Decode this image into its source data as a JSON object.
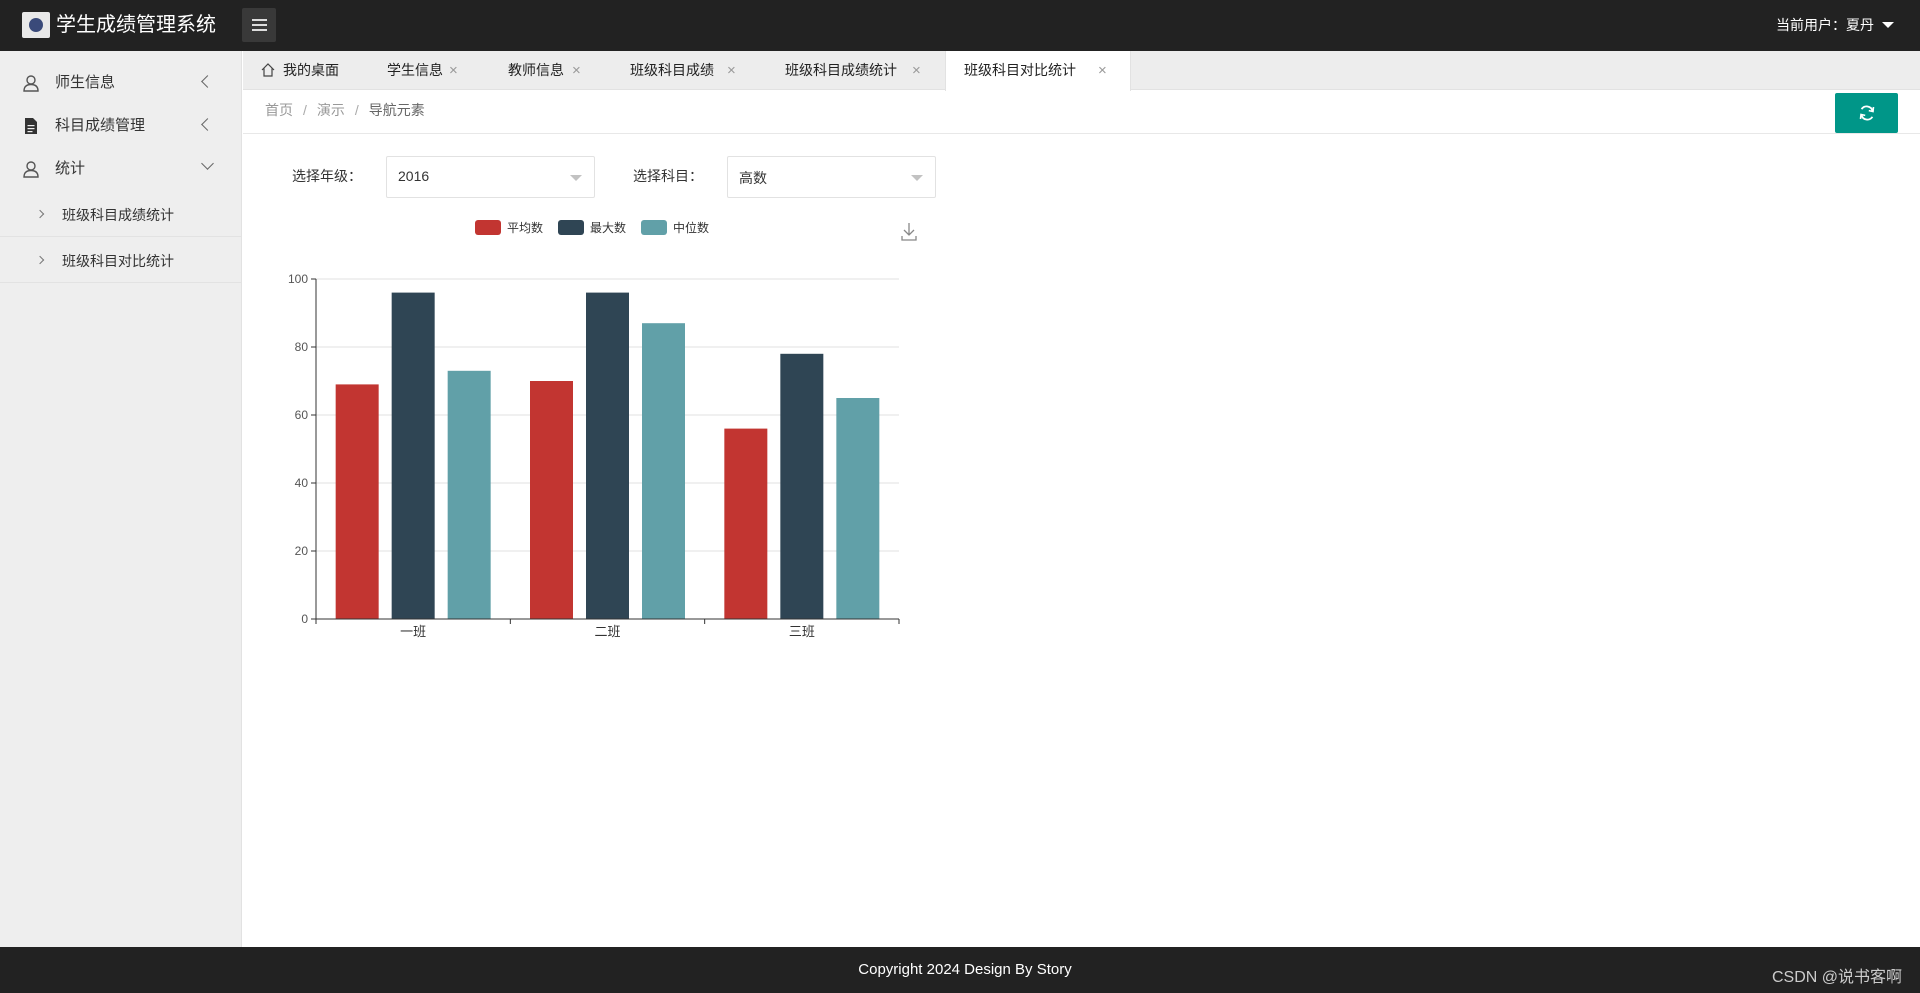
{
  "header": {
    "app_title": "学生成绩管理系统",
    "user_label": "当前用户：夏丹"
  },
  "sidebar": {
    "items": [
      {
        "label": "师生信息",
        "icon": "user-icon",
        "state": "collapsed"
      },
      {
        "label": "科目成绩管理",
        "icon": "document-icon",
        "state": "collapsed"
      },
      {
        "label": "统计",
        "icon": "user-icon",
        "state": "expanded"
      }
    ],
    "sub_items": [
      {
        "label": "班级科目成绩统计"
      },
      {
        "label": "班级科目对比统计"
      }
    ]
  },
  "tabs": [
    {
      "label": "我的桌面",
      "closable": false
    },
    {
      "label": "学生信息",
      "closable": true
    },
    {
      "label": "教师信息",
      "closable": true
    },
    {
      "label": "班级科目成绩",
      "closable": true
    },
    {
      "label": "班级科目成绩统计",
      "closable": true
    },
    {
      "label": "班级科目对比统计",
      "closable": true,
      "active": true
    }
  ],
  "tab_close_glyph": "×",
  "breadcrumb": {
    "items": [
      "首页",
      "演示",
      "导航元素"
    ],
    "separator": "/"
  },
  "filters": {
    "grade_label": "选择年级：",
    "grade_value": "2016",
    "subject_label": "选择科目：",
    "subject_value": "高数"
  },
  "colors": {
    "header_bg": "#222222",
    "accent": "#009688",
    "series_avg": "#c23531",
    "series_max": "#2f4554",
    "series_median": "#61a0a8"
  },
  "chart_data": {
    "type": "bar",
    "categories": [
      "一班",
      "二班",
      "三班"
    ],
    "series": [
      {
        "name": "平均数",
        "values": [
          69,
          70,
          56
        ]
      },
      {
        "name": "最大数",
        "values": [
          96,
          96,
          78
        ]
      },
      {
        "name": "中位数",
        "values": [
          73,
          87,
          65
        ]
      }
    ],
    "ylim": [
      0,
      100
    ],
    "yticks": [
      0,
      20,
      40,
      60,
      80,
      100
    ],
    "grid": true,
    "legend_position": "top"
  },
  "footer": {
    "copyright": "Copyright 2024 Design By Story",
    "watermark": "CSDN @说书客啊"
  }
}
